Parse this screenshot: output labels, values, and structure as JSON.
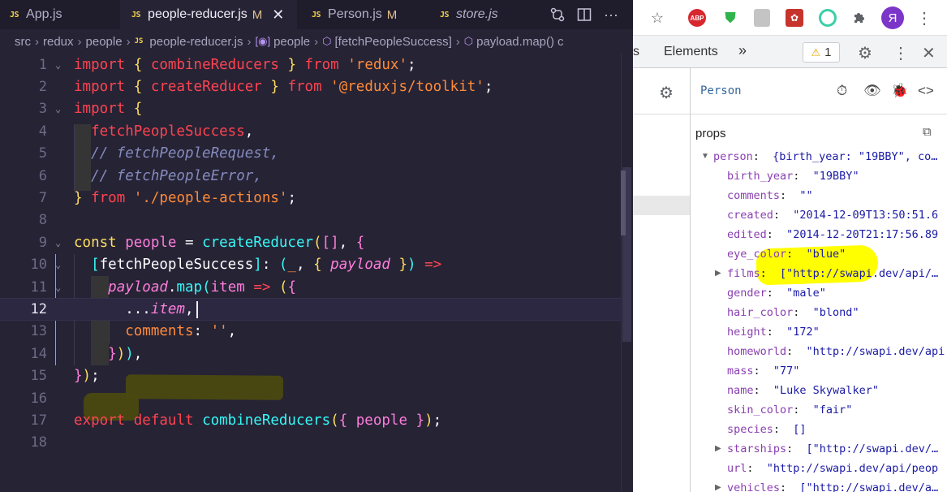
{
  "editor": {
    "tabs": [
      {
        "label": "App.js",
        "modified": "",
        "italic": false,
        "active": false,
        "close": ""
      },
      {
        "label": "people-reducer.js",
        "modified": "M",
        "italic": false,
        "active": true,
        "close": "✕"
      },
      {
        "label": "Person.js",
        "modified": "M",
        "italic": false,
        "active": false,
        "close": ""
      },
      {
        "label": "store.js",
        "modified": "",
        "italic": true,
        "active": false,
        "close": ""
      }
    ],
    "file_icon_text": "JS",
    "breadcrumb": [
      "src",
      "redux",
      "people",
      "people-reducer.js",
      "people",
      "[fetchPeopleSuccess]",
      "payload.map()"
    ],
    "breadcrumb_more": "c",
    "current_line": 12,
    "line_numbers": [
      "1",
      "2",
      "3",
      "4",
      "5",
      "6",
      "7",
      "8",
      "9",
      "10",
      "11",
      "12",
      "13",
      "14",
      "15",
      "16",
      "17",
      "18"
    ]
  },
  "devtools": {
    "tabs_partial": "s",
    "elements_tab": "Elements",
    "more_tabs": "»",
    "warning_count": "1",
    "component_name": "Person",
    "props_label": "props",
    "props": [
      {
        "key": "person",
        "value": "{birth_year: \"19BBY\", co…",
        "expandable": true,
        "expanded": true,
        "level": 0
      },
      {
        "key": "birth_year",
        "value": "\"19BBY\"",
        "level": 1
      },
      {
        "key": "comments",
        "value": "\"\"",
        "level": 1
      },
      {
        "key": "created",
        "value": "\"2014-12-09T13:50:51.6",
        "level": 1
      },
      {
        "key": "edited",
        "value": "\"2014-12-20T21:17:56.89",
        "level": 1
      },
      {
        "key": "eye_color",
        "value": "\"blue\"",
        "level": 1
      },
      {
        "key": "films",
        "value": "[\"http://swapi.dev/api/…",
        "expandable": true,
        "level": 1
      },
      {
        "key": "gender",
        "value": "\"male\"",
        "level": 1
      },
      {
        "key": "hair_color",
        "value": "\"blond\"",
        "level": 1
      },
      {
        "key": "height",
        "value": "\"172\"",
        "level": 1
      },
      {
        "key": "homeworld",
        "value": "\"http://swapi.dev/api",
        "level": 1
      },
      {
        "key": "mass",
        "value": "\"77\"",
        "level": 1
      },
      {
        "key": "name",
        "value": "\"Luke Skywalker\"",
        "level": 1
      },
      {
        "key": "skin_color",
        "value": "\"fair\"",
        "level": 1
      },
      {
        "key": "species",
        "value": "[]",
        "level": 1
      },
      {
        "key": "starships",
        "value": "[\"http://swapi.dev/…",
        "expandable": true,
        "level": 1
      },
      {
        "key": "url",
        "value": "\"http://swapi.dev/api/peop",
        "level": 1
      },
      {
        "key": "vehicles",
        "value": "[\"http://swapi.dev/a…",
        "expandable": true,
        "level": 1
      }
    ]
  },
  "browser": {
    "abp_label": "ABP",
    "profile_initial": "Я"
  },
  "colors": {
    "editor_bg": "#262335",
    "keyword": "#fe4450",
    "function": "#36f9f6",
    "string": "#ff8b39",
    "variable": "#ff7edb",
    "highlighter": "#ffff00"
  }
}
